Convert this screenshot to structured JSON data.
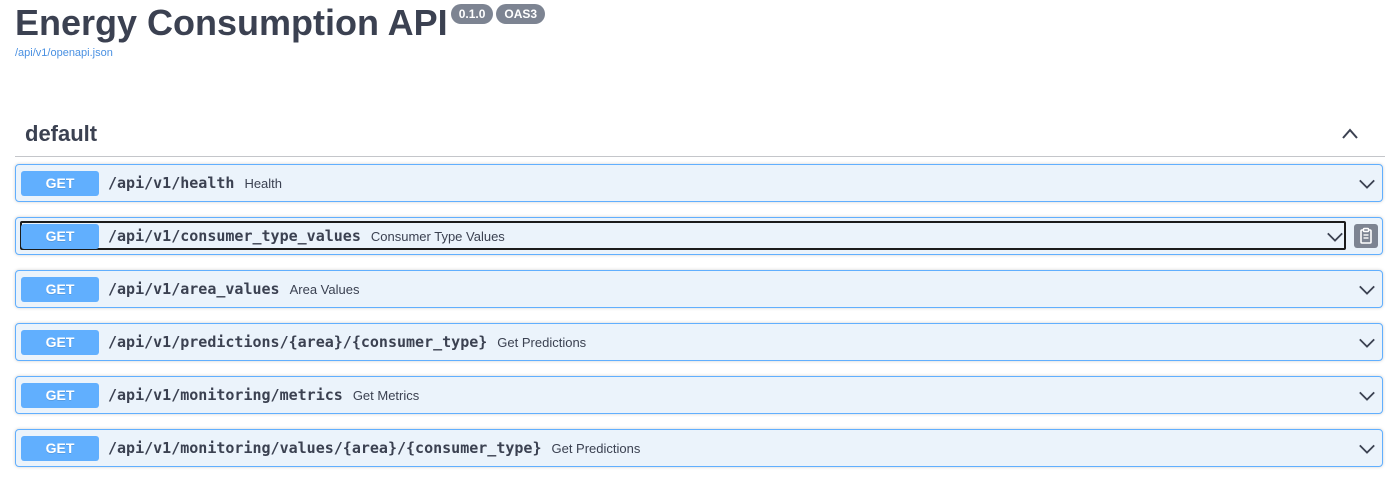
{
  "api": {
    "title": "Energy Consumption API",
    "version_badge": "0.1.0",
    "oas_badge": "OAS3",
    "spec_link": "/api/v1/openapi.json"
  },
  "tag": {
    "name": "default",
    "collapse_icon": "chevron-up-icon"
  },
  "colors": {
    "get_accent": "#61affe",
    "get_background": "#ebf3fb",
    "text": "#3b4151",
    "badge": "#7d8492",
    "link": "#4990e2"
  },
  "operations": [
    {
      "method": "GET",
      "path": "/api/v1/health",
      "summary": "Health"
    },
    {
      "method": "GET",
      "path": "/api/v1/consumer_type_values",
      "summary": "Consumer Type Values"
    },
    {
      "method": "GET",
      "path": "/api/v1/area_values",
      "summary": "Area Values"
    },
    {
      "method": "GET",
      "path": "/api/v1/predictions/{area}/{consumer_type}",
      "summary": "Get Predictions"
    },
    {
      "method": "GET",
      "path": "/api/v1/monitoring/metrics",
      "summary": "Get Metrics"
    },
    {
      "method": "GET",
      "path": "/api/v1/monitoring/values/{area}/{consumer_type}",
      "summary": "Get Predictions"
    }
  ]
}
